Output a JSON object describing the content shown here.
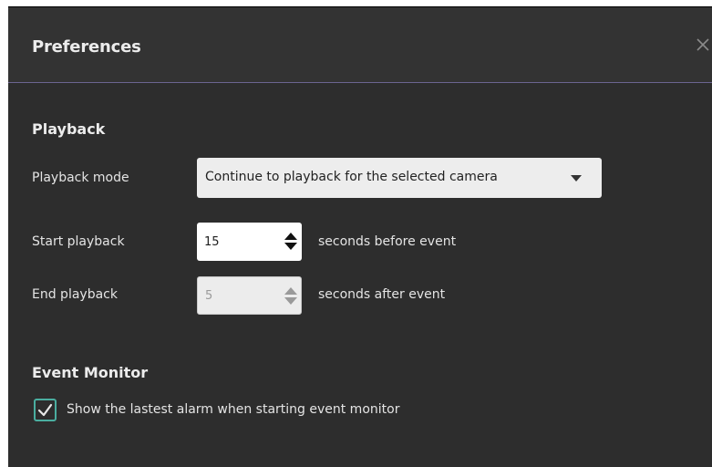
{
  "dialog": {
    "title": "Preferences"
  },
  "playback": {
    "section_title": "Playback",
    "mode": {
      "label": "Playback mode",
      "value": "Continue to playback for the selected camera"
    },
    "start": {
      "label": "Start playback",
      "value": "15",
      "suffix": "seconds before event"
    },
    "end": {
      "label": "End playback",
      "value": "5",
      "suffix": "seconds after event",
      "disabled": true
    }
  },
  "event_monitor": {
    "section_title": "Event Monitor",
    "show_latest_alarm": {
      "label": "Show the lastest alarm when starting event monitor",
      "checked": true
    }
  },
  "colors": {
    "background": "#2d2d2d",
    "accent": "#4aaea0",
    "divider": "#6b6490"
  }
}
